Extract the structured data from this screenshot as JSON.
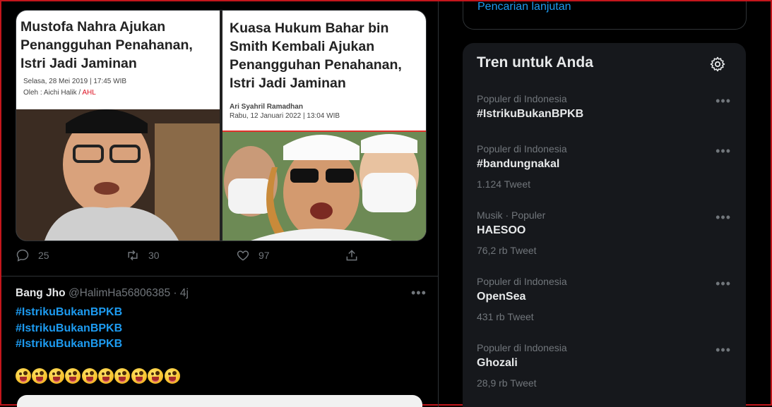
{
  "top_tweet": {
    "media": {
      "left": {
        "headline": "Mustofa Nahra Ajukan Penangguhan Penahanan, Istri Jadi Jaminan",
        "date": "Selasa, 28 Mei 2019 | 17:45 WIB",
        "author_prefix": "Oleh : Aichi Halik / ",
        "author_tag": "AHL"
      },
      "right": {
        "headline": "Kuasa Hukum Bahar bin Smith Kembali Ajukan Penangguhan Penahanan, Istri Jadi Jaminan",
        "author": "Ari Syahril Ramadhan",
        "date": "Rabu, 12 Januari 2022 | 13:04 WIB"
      }
    },
    "actions": {
      "reply_count": "25",
      "retweet_count": "30",
      "like_count": "97"
    }
  },
  "tweet": {
    "display_name": "Bang Jho",
    "handle": "@HalimHa56806385",
    "separator": "·",
    "time": "4j",
    "more": "•••",
    "hashtags": [
      "#IstrikuBukanBPKB",
      "#IstrikuBukanBPKB",
      "#IstrikuBukanBPKB"
    ],
    "emoji_count": 10
  },
  "sidebar": {
    "advanced_search_link": "Pencarian lanjutan",
    "trends_title": "Tren untuk Anda",
    "trends": [
      {
        "context": "Populer di Indonesia",
        "name": "#IstrikuBukanBPKB",
        "count": "",
        "more": "•••"
      },
      {
        "context": "Populer di Indonesia",
        "name": "#bandungnakal",
        "count": "1.124 Tweet",
        "more": "•••"
      },
      {
        "context": "Musik · Populer",
        "name": "HAESOO",
        "count": "76,2 rb Tweet",
        "more": "•••"
      },
      {
        "context": "Populer di Indonesia",
        "name": "OpenSea",
        "count": "431 rb Tweet",
        "more": "•••"
      },
      {
        "context": "Populer di Indonesia",
        "name": "Ghozali",
        "count": "28,9 rb Tweet",
        "more": "•••"
      }
    ]
  },
  "colors": {
    "accent": "#1d9bf0",
    "background": "#000000",
    "panel": "#16181c",
    "muted": "#71767b",
    "window_border": "#c4161c"
  }
}
